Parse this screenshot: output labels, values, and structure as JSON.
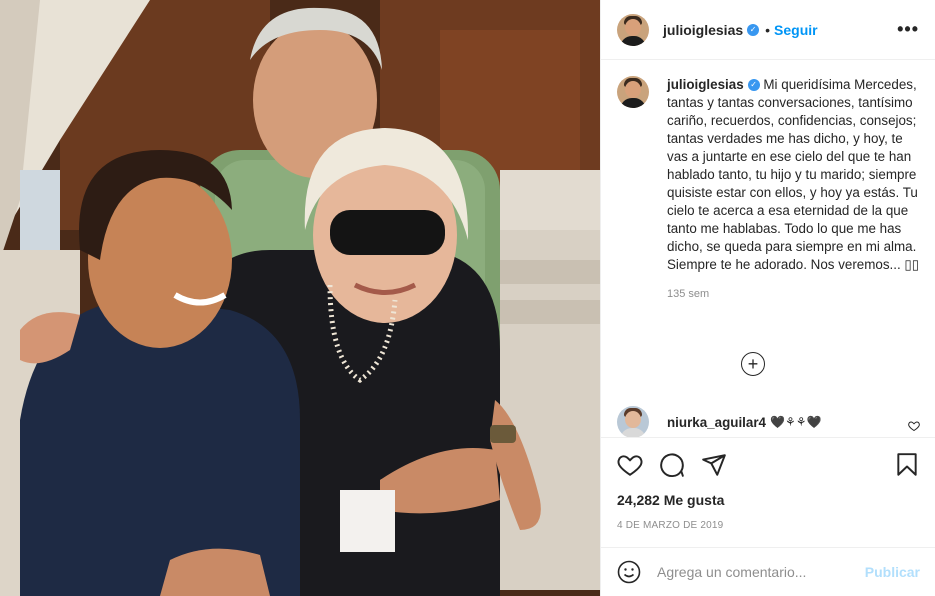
{
  "post": {
    "username": "julioiglesias",
    "follow_label": "Seguir",
    "dot": "•",
    "more_label": "•••",
    "caption": "Mi queridísima Mercedes, tantas y tantas conversaciones, tantísimo cariño, recuerdos, confidencias, consejos; tantas verdades me has dicho, y hoy, te vas a juntarte en ese cielo del que te han hablado tanto, tu hijo y tu marido; siempre quisiste estar con ellos, y hoy ya estás. Tu cielo te acerca a esa eternidad de la que tanto me hablabas. Todo lo que me has dicho, se queda para siempre en mi alma. Siempre te he adorado. Nos veremos... ▯▯",
    "time": "135 sem",
    "likes": "24,282 Me gusta",
    "date": "4 DE MARZO DE 2019"
  },
  "comment": {
    "username": "niurka_aguilar4",
    "text": "🖤⚘⚘🖤"
  },
  "add_comment": {
    "placeholder": "Agrega un comentario...",
    "publish_label": "Publicar"
  },
  "colors": {
    "accent": "#0095f6",
    "verified": "#3897f0",
    "muted": "#8e8e8e",
    "publish_disabled": "#b2dffc"
  }
}
